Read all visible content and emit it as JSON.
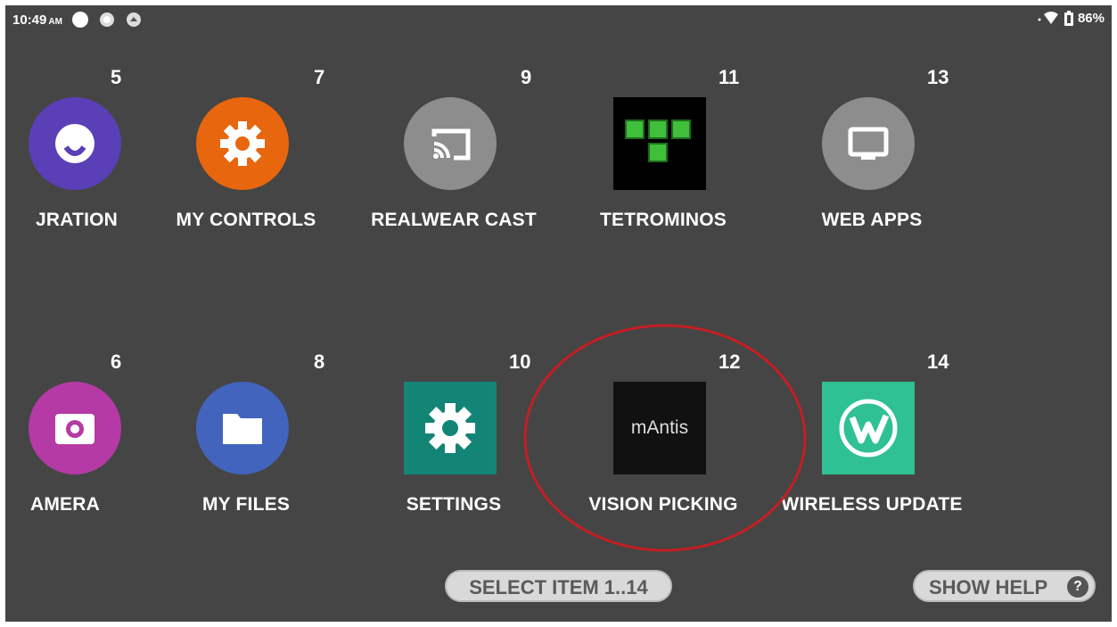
{
  "status_bar": {
    "time": "10:49",
    "ampm": "AM",
    "battery": "86%"
  },
  "apps": [
    {
      "number": "5",
      "label": "JRATION",
      "icon": "configuration-icon",
      "color": "#5a3fb7"
    },
    {
      "number": "6",
      "label": "AMERA",
      "icon": "camera-icon",
      "color": "#b53aa5"
    },
    {
      "number": "7",
      "label": "MY CONTROLS",
      "icon": "gear-icon",
      "color": "#e8660d"
    },
    {
      "number": "8",
      "label": "MY FILES",
      "icon": "folder-icon",
      "color": "#4264bd"
    },
    {
      "number": "9",
      "label": "REALWEAR CAST",
      "icon": "cast-icon",
      "color": "#8d8d8d"
    },
    {
      "number": "10",
      "label": "SETTINGS",
      "icon": "settings-gear-icon",
      "color": "#138577"
    },
    {
      "number": "11",
      "label": "TETROMINOS",
      "icon": "tetrominos-icon",
      "color": "#000000"
    },
    {
      "number": "12",
      "label": "VISION PICKING",
      "icon": "mantis-logo-icon",
      "color": "#111111",
      "logo_text": "mAntis"
    },
    {
      "number": "13",
      "label": "WEB APPS",
      "icon": "monitor-icon",
      "color": "#8d8d8d"
    },
    {
      "number": "14",
      "label": "WIRELESS UPDATE",
      "icon": "wireless-update-icon",
      "color": "#2fc093"
    }
  ],
  "footer": {
    "select_label": "SELECT ITEM 1..14",
    "help_label": "SHOW HELP",
    "help_icon": "?"
  },
  "highlight_color": "#c41e24"
}
